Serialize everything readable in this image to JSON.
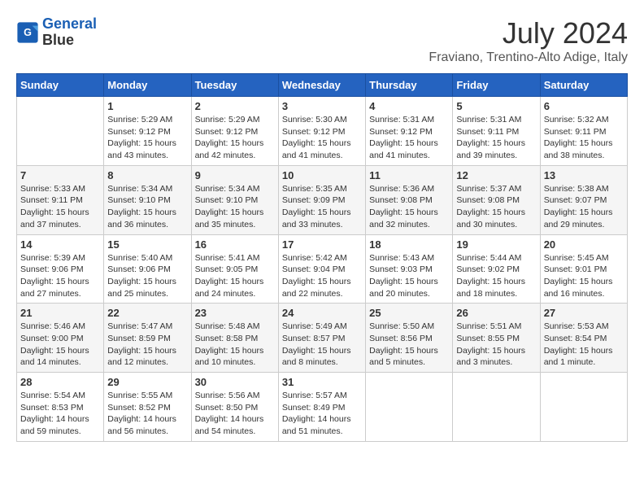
{
  "header": {
    "logo_line1": "General",
    "logo_line2": "Blue",
    "month": "July 2024",
    "location": "Fraviano, Trentino-Alto Adige, Italy"
  },
  "weekdays": [
    "Sunday",
    "Monday",
    "Tuesday",
    "Wednesday",
    "Thursday",
    "Friday",
    "Saturday"
  ],
  "weeks": [
    [
      {
        "day": "",
        "info": ""
      },
      {
        "day": "1",
        "info": "Sunrise: 5:29 AM\nSunset: 9:12 PM\nDaylight: 15 hours\nand 43 minutes."
      },
      {
        "day": "2",
        "info": "Sunrise: 5:29 AM\nSunset: 9:12 PM\nDaylight: 15 hours\nand 42 minutes."
      },
      {
        "day": "3",
        "info": "Sunrise: 5:30 AM\nSunset: 9:12 PM\nDaylight: 15 hours\nand 41 minutes."
      },
      {
        "day": "4",
        "info": "Sunrise: 5:31 AM\nSunset: 9:12 PM\nDaylight: 15 hours\nand 41 minutes."
      },
      {
        "day": "5",
        "info": "Sunrise: 5:31 AM\nSunset: 9:11 PM\nDaylight: 15 hours\nand 39 minutes."
      },
      {
        "day": "6",
        "info": "Sunrise: 5:32 AM\nSunset: 9:11 PM\nDaylight: 15 hours\nand 38 minutes."
      }
    ],
    [
      {
        "day": "7",
        "info": "Sunrise: 5:33 AM\nSunset: 9:11 PM\nDaylight: 15 hours\nand 37 minutes."
      },
      {
        "day": "8",
        "info": "Sunrise: 5:34 AM\nSunset: 9:10 PM\nDaylight: 15 hours\nand 36 minutes."
      },
      {
        "day": "9",
        "info": "Sunrise: 5:34 AM\nSunset: 9:10 PM\nDaylight: 15 hours\nand 35 minutes."
      },
      {
        "day": "10",
        "info": "Sunrise: 5:35 AM\nSunset: 9:09 PM\nDaylight: 15 hours\nand 33 minutes."
      },
      {
        "day": "11",
        "info": "Sunrise: 5:36 AM\nSunset: 9:08 PM\nDaylight: 15 hours\nand 32 minutes."
      },
      {
        "day": "12",
        "info": "Sunrise: 5:37 AM\nSunset: 9:08 PM\nDaylight: 15 hours\nand 30 minutes."
      },
      {
        "day": "13",
        "info": "Sunrise: 5:38 AM\nSunset: 9:07 PM\nDaylight: 15 hours\nand 29 minutes."
      }
    ],
    [
      {
        "day": "14",
        "info": "Sunrise: 5:39 AM\nSunset: 9:06 PM\nDaylight: 15 hours\nand 27 minutes."
      },
      {
        "day": "15",
        "info": "Sunrise: 5:40 AM\nSunset: 9:06 PM\nDaylight: 15 hours\nand 25 minutes."
      },
      {
        "day": "16",
        "info": "Sunrise: 5:41 AM\nSunset: 9:05 PM\nDaylight: 15 hours\nand 24 minutes."
      },
      {
        "day": "17",
        "info": "Sunrise: 5:42 AM\nSunset: 9:04 PM\nDaylight: 15 hours\nand 22 minutes."
      },
      {
        "day": "18",
        "info": "Sunrise: 5:43 AM\nSunset: 9:03 PM\nDaylight: 15 hours\nand 20 minutes."
      },
      {
        "day": "19",
        "info": "Sunrise: 5:44 AM\nSunset: 9:02 PM\nDaylight: 15 hours\nand 18 minutes."
      },
      {
        "day": "20",
        "info": "Sunrise: 5:45 AM\nSunset: 9:01 PM\nDaylight: 15 hours\nand 16 minutes."
      }
    ],
    [
      {
        "day": "21",
        "info": "Sunrise: 5:46 AM\nSunset: 9:00 PM\nDaylight: 15 hours\nand 14 minutes."
      },
      {
        "day": "22",
        "info": "Sunrise: 5:47 AM\nSunset: 8:59 PM\nDaylight: 15 hours\nand 12 minutes."
      },
      {
        "day": "23",
        "info": "Sunrise: 5:48 AM\nSunset: 8:58 PM\nDaylight: 15 hours\nand 10 minutes."
      },
      {
        "day": "24",
        "info": "Sunrise: 5:49 AM\nSunset: 8:57 PM\nDaylight: 15 hours\nand 8 minutes."
      },
      {
        "day": "25",
        "info": "Sunrise: 5:50 AM\nSunset: 8:56 PM\nDaylight: 15 hours\nand 5 minutes."
      },
      {
        "day": "26",
        "info": "Sunrise: 5:51 AM\nSunset: 8:55 PM\nDaylight: 15 hours\nand 3 minutes."
      },
      {
        "day": "27",
        "info": "Sunrise: 5:53 AM\nSunset: 8:54 PM\nDaylight: 15 hours\nand 1 minute."
      }
    ],
    [
      {
        "day": "28",
        "info": "Sunrise: 5:54 AM\nSunset: 8:53 PM\nDaylight: 14 hours\nand 59 minutes."
      },
      {
        "day": "29",
        "info": "Sunrise: 5:55 AM\nSunset: 8:52 PM\nDaylight: 14 hours\nand 56 minutes."
      },
      {
        "day": "30",
        "info": "Sunrise: 5:56 AM\nSunset: 8:50 PM\nDaylight: 14 hours\nand 54 minutes."
      },
      {
        "day": "31",
        "info": "Sunrise: 5:57 AM\nSunset: 8:49 PM\nDaylight: 14 hours\nand 51 minutes."
      },
      {
        "day": "",
        "info": ""
      },
      {
        "day": "",
        "info": ""
      },
      {
        "day": "",
        "info": ""
      }
    ]
  ]
}
